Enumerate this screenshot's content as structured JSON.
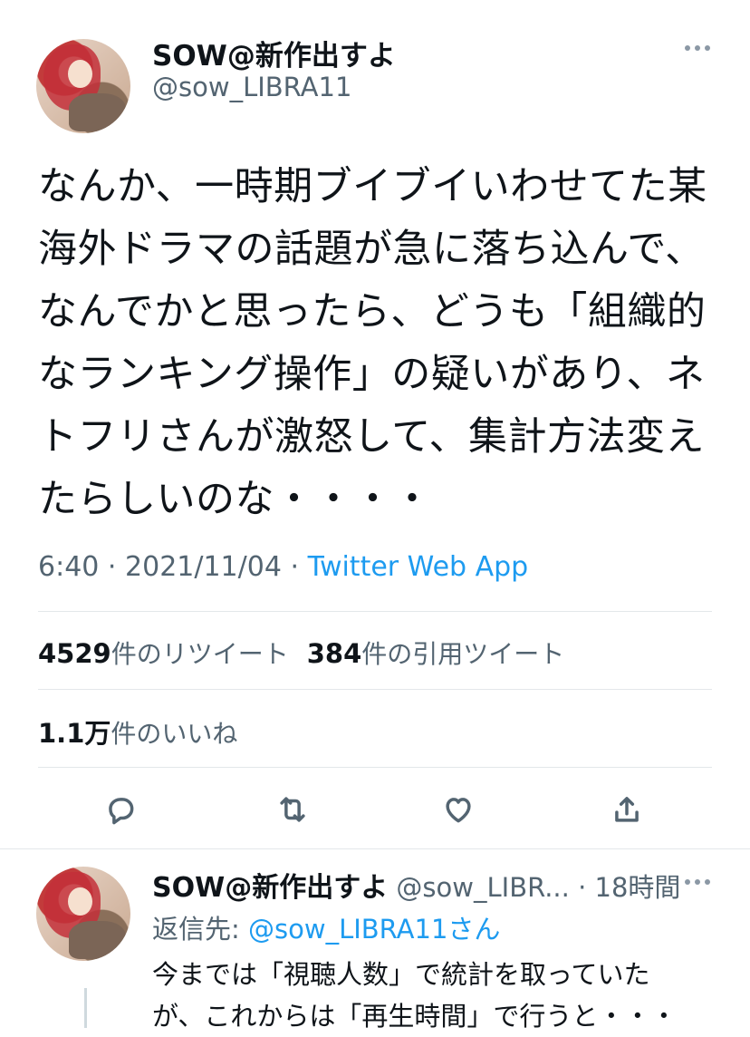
{
  "tweet": {
    "author_name": "SOW@新作出すよ",
    "author_handle": "@sow_LIBRA11",
    "text": "なんか、一時期ブイブイいわせてた某\n海外ドラマの話題が急に落ち込んで、\nなんでかと思ったら、どうも「組織的\nなランキング操作」の疑いがあり、ネ\nトフリさんが激怒して、集計方法変え\nたらしいのな・・・・",
    "time": "6:40",
    "date": "2021/11/04",
    "separator": "·",
    "app": "Twitter Web App",
    "retweets_count": "4529",
    "retweets_label": "件のリツイート",
    "quotes_count": "384",
    "quotes_label": "件の引用ツイート",
    "likes_count": "1.1万",
    "likes_label": "件のいいね",
    "actions": [
      "reply-icon",
      "retweet-icon",
      "like-icon",
      "share-icon"
    ]
  },
  "reply": {
    "author_name": "SOW@新作出すよ",
    "author_handle": "@sow_LIBR...",
    "separator": "·",
    "time": "18時間",
    "reply_to_label": "返信先: ",
    "reply_to_handle": "@sow_LIBRA11さん",
    "text": "今までは「視聴人数」で統計を取っていた\nが、これからは「再生時間」で行うと・・・"
  },
  "colors": {
    "text": "#0f1419",
    "secondary": "#536471",
    "link": "#1d9bf0",
    "divider": "#e3e7ea"
  }
}
